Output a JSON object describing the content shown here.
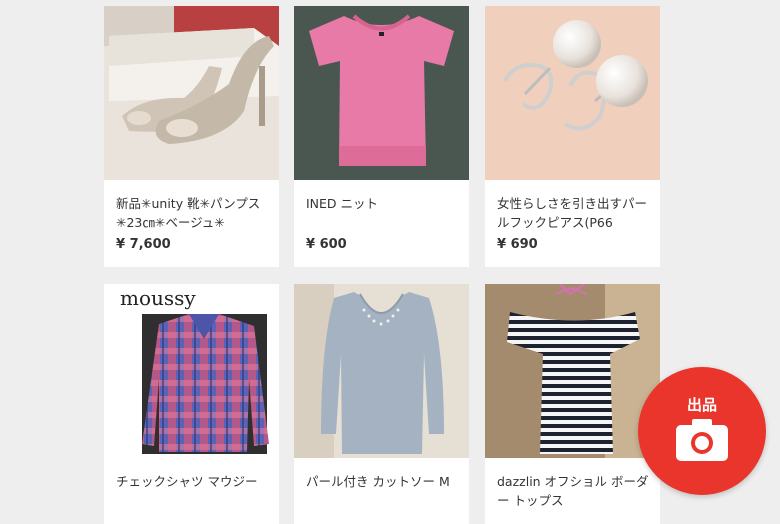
{
  "items": [
    {
      "title": "新品✳︎unity 靴✳︎パンプス ✳︎23㎝✳︎ベージュ✳︎",
      "price": "¥ 7,600"
    },
    {
      "title": "INED ニット",
      "price": "¥ 600"
    },
    {
      "title": "女性らしさを引き出すパールフックピアス(P66",
      "price": "¥ 690"
    },
    {
      "title": "チェックシャツ マウジー",
      "price": ""
    },
    {
      "title": "パール付き カットソー M",
      "price": ""
    },
    {
      "title": "dazzlin オフショル ボーダー トップス",
      "price": ""
    }
  ],
  "image_text": {
    "moussy_logo": "moussy"
  },
  "sell_button": {
    "label": "出品",
    "icon": "camera-icon",
    "color": "#ea352d"
  }
}
